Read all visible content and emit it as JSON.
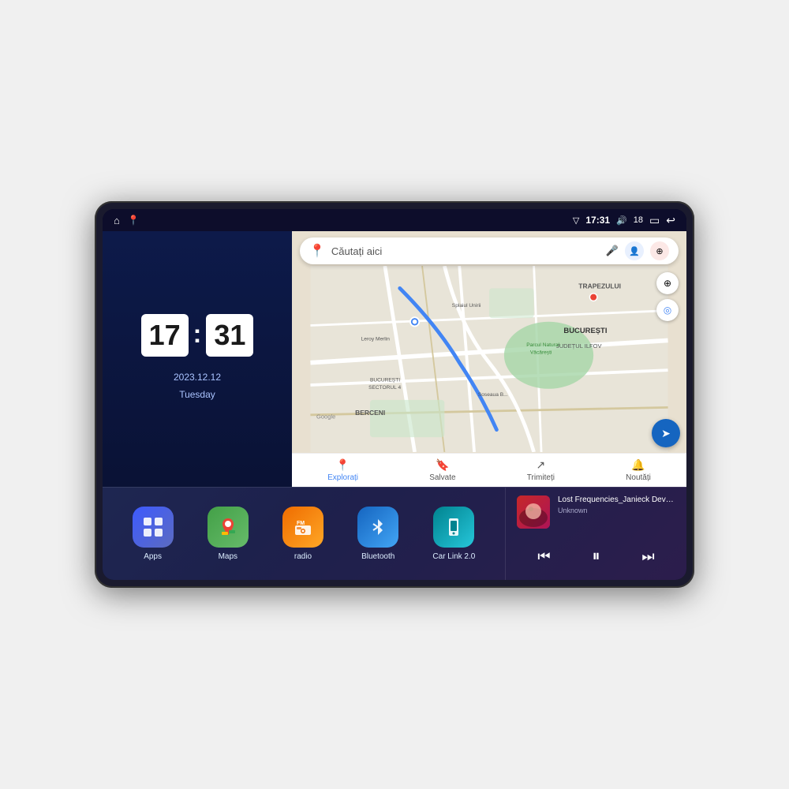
{
  "device": {
    "screen": {
      "status_bar": {
        "left_icons": [
          "home",
          "maps"
        ],
        "time": "17:31",
        "signal_icon": "▽",
        "volume_icon": "🔊",
        "volume_level": "18",
        "battery_icon": "▭",
        "back_icon": "↩"
      },
      "clock": {
        "hours": "17",
        "minutes": "31",
        "date": "2023.12.12",
        "day": "Tuesday"
      },
      "map": {
        "search_placeholder": "Căutați aici",
        "bottom_nav": [
          {
            "label": "Explorați",
            "active": true
          },
          {
            "label": "Salvate",
            "active": false
          },
          {
            "label": "Trimiteți",
            "active": false
          },
          {
            "label": "Noutăți",
            "active": false
          }
        ],
        "labels": [
          "TRAPEZULUI",
          "BUCUREȘTI",
          "JUDEȚUL ILFOV",
          "BERCENI",
          "BUCUREȘTI SECTORUL 4",
          "Leroy Merlin",
          "Parcul Natural Văcărești",
          "Soseaua B..."
        ]
      },
      "apps": [
        {
          "id": "apps",
          "label": "Apps",
          "icon_type": "apps-icon",
          "symbol": "⊞"
        },
        {
          "id": "maps",
          "label": "Maps",
          "icon_type": "maps-icon",
          "symbol": "📍"
        },
        {
          "id": "radio",
          "label": "radio",
          "icon_type": "radio-icon",
          "symbol": "📻"
        },
        {
          "id": "bluetooth",
          "label": "Bluetooth",
          "icon_type": "bluetooth-icon",
          "symbol": "⬡"
        },
        {
          "id": "carlink",
          "label": "Car Link 2.0",
          "icon_type": "carlink-icon",
          "symbol": "📱"
        }
      ],
      "music": {
        "title": "Lost Frequencies_Janieck Devy-...",
        "artist": "Unknown",
        "controls": {
          "prev": "⏮",
          "play": "⏸",
          "next": "⏭"
        }
      }
    }
  }
}
